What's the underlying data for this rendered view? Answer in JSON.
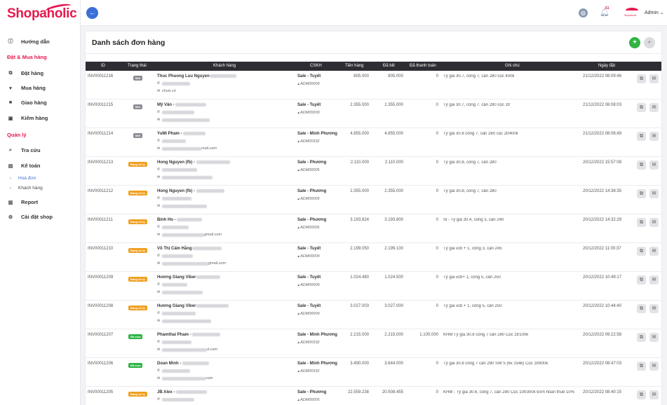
{
  "app": {
    "logo": "Shopaholic",
    "brand_color": "#e5194f",
    "accent": "#3b6fd8"
  },
  "sidebar": {
    "items": [
      {
        "label": "Hướng dẫn",
        "icon": "info-icon"
      },
      {
        "section": "Đặt & Mua hàng"
      },
      {
        "label": "Đặt hàng",
        "icon": "copy-icon"
      },
      {
        "label": "Mua hàng",
        "icon": "cart-icon"
      },
      {
        "label": "Giao hàng",
        "icon": "truck-icon"
      },
      {
        "label": "Kiểm hàng",
        "icon": "box-icon"
      },
      {
        "section": "Quản lý"
      },
      {
        "label": "Tra cứu",
        "icon": "search-icon"
      },
      {
        "label": "Kế toán",
        "icon": "book-icon"
      },
      {
        "sub": "Hoá đơn",
        "active": true
      },
      {
        "sub": "Khách hàng"
      },
      {
        "label": "Report",
        "icon": "chart-icon"
      },
      {
        "label": "Cài đặt shop",
        "icon": "gear-icon"
      }
    ]
  },
  "topbar": {
    "notification_count": "61",
    "avatar_text": "Shopaholic",
    "user": "Admin"
  },
  "page": {
    "title": "Danh sách đơn hàng"
  },
  "table": {
    "headers": [
      "ID",
      "Trạng thái",
      "Khách hàng",
      "CSKH",
      "Tiền hàng",
      "Đã bill",
      "Đã thanh toán",
      "Ghi chú",
      "Ngày đặt"
    ],
    "rows": [
      {
        "id": "INV00011216",
        "status": "Mới",
        "status_type": "moi",
        "customer": "Thuc Phuong Luu Nguyen",
        "email": "chưa có",
        "cskh": "Sale - Tuyết",
        "cskh_code": "ADM00009",
        "tien_hang": "805.000",
        "da_bill": "805.000",
        "da_tt": "0",
        "note": "Tỷ giá 30.7, công 7, cân 280 cọc 400k",
        "date": "21/12/2022 08:09:46"
      },
      {
        "id": "INV00011215",
        "status": "Mới",
        "status_type": "moi",
        "customer": "Mỹ Vân - ",
        "email": "",
        "cskh": "Sale - Tuyết",
        "cskh_code": "ADM00009",
        "tien_hang": "2.355.000",
        "da_bill": "2.355.000",
        "da_tt": "0",
        "note": "Tỷ giá 30.7, công 7. cân 280 cọc 1tr",
        "date": "21/12/2022 08:08:03"
      },
      {
        "id": "INV00011214",
        "status": "Mới",
        "status_type": "moi",
        "customer": "YuMi Pham - ",
        "email": "mail.com",
        "cskh": "Sale - Minh Phương",
        "cskh_code": "ADM00332",
        "tien_hang": "4.855.000",
        "da_bill": "4.855.000",
        "da_tt": "0",
        "note": "Tỷ giá 30.8 công 7, cân 280 cọc 2tr400k",
        "date": "21/12/2022 08:06:49"
      },
      {
        "id": "INV00011213",
        "status": "Đang xử lý",
        "status_type": "xuly",
        "customer": "Hong Nguyen (fb) - ",
        "email": "",
        "cskh": "Sale - Phương",
        "cskh_code": "ADM00005",
        "tien_hang": "2.110.000",
        "da_bill": "2.110.000",
        "da_tt": "0",
        "note": "Tỷ giá 30.8, công 7, cân 280",
        "date": "20/12/2022 15:57:08"
      },
      {
        "id": "INV00011212",
        "status": "Đang xử lý",
        "status_type": "xuly",
        "customer": "Hong Nguyen (fb) - ",
        "email": "",
        "cskh": "Sale - Phương",
        "cskh_code": "ADM00005",
        "tien_hang": "2.355.000",
        "da_bill": "2.355.000",
        "da_tt": "0",
        "note": "Tỷ giá 30.8, công 7, cân 280",
        "date": "20/12/2022 14:38:35"
      },
      {
        "id": "INV00011211",
        "status": "Đang xử lý",
        "status_type": "xuly",
        "customer": "Binh Ho - ",
        "email": "gmail.com",
        "cskh": "Sale - Phương",
        "cskh_code": "ADM00005",
        "tien_hang": "3.193.824",
        "da_bill": "3.193.800",
        "da_tt": "0",
        "note": "Sỉ - Tỷ giá 30.4, công 3, cân 240",
        "date": "20/12/2022 14:32:29"
      },
      {
        "id": "INV00011210",
        "status": "Đang xử lý",
        "status_type": "xuly",
        "customer": "Võ Thị Cẩm Hằng",
        "email": "gmail.com",
        "cskh": "Sale - Tuyết",
        "cskh_code": "ADM00009",
        "tien_hang": "2.199.050",
        "da_bill": "2.199.100",
        "da_tt": "0",
        "note": "Tỷ giá vcb + 1, công 3, cân 245",
        "date": "20/12/2022 11:00:37"
      },
      {
        "id": "INV00011209",
        "status": "Đang xử lý",
        "status_type": "xuly",
        "customer": "Hương Giang Viber",
        "email": "",
        "cskh": "Sale - Tuyết",
        "cskh_code": "ADM00009",
        "tien_hang": "1.024.480",
        "da_bill": "1.024.500",
        "da_tt": "0",
        "note": "Tỷ giá vcb+ 1, công 5, cân 250",
        "date": "20/12/2022 10:49:17"
      },
      {
        "id": "INV00011208",
        "status": "Đang xử lý",
        "status_type": "xuly",
        "customer": "Hương Giang Viber",
        "email": "",
        "cskh": "Sale - Tuyết",
        "cskh_code": "ADM00009",
        "tien_hang": "3.027.003",
        "da_bill": "3.027.000",
        "da_tt": "0",
        "note": "Tỷ giá vcb + 1, công 5, cân 250",
        "date": "20/12/2022 10:44:40"
      },
      {
        "id": "INV00011207",
        "status": "Đã mua",
        "status_type": "mua",
        "customer": "Phamthai Pham - ",
        "email": "d.com",
        "cskh": "Sale - Minh Phương",
        "cskh_code": "ADM00332",
        "tien_hang": "2.215.000",
        "da_bill": "2.215.000",
        "da_tt": "1.100.000",
        "note": "KHM Tỷ giá 30.8 công 7 cân 280 Cọc 1tr100k",
        "date": "20/12/2022 09:22:58"
      },
      {
        "id": "INV00011206",
        "status": "Đã mua",
        "status_type": "mua",
        "customer": "Doan Minh - ",
        "email": "com",
        "cskh": "Sale - Minh Phương",
        "cskh_code": "ADM00332",
        "tien_hang": "3.490.000",
        "da_bill": "3.644.000",
        "da_tt": "0",
        "note": "Tỷ giá 30.8 công 7 cân 280 SW 5 (6x 154k) Cọc 1tr800k",
        "date": "20/12/2022 08:47:03"
      },
      {
        "id": "INV00011205",
        "status": "Đang xử lý",
        "status_type": "xuly",
        "customer": "JB Alex - ",
        "email": "",
        "cskh": "Sale - Phương",
        "cskh_code": "ADM00005",
        "tien_hang": "22.559.238",
        "da_bill": "20.508.455",
        "da_tt": "0",
        "note": "KHM - Tỷ giá 30.6, công 7, cân 280 Cọc 10tr300k Đơn hoàn thuế 10%",
        "date": "20/12/2022 08:40:15"
      }
    ]
  }
}
